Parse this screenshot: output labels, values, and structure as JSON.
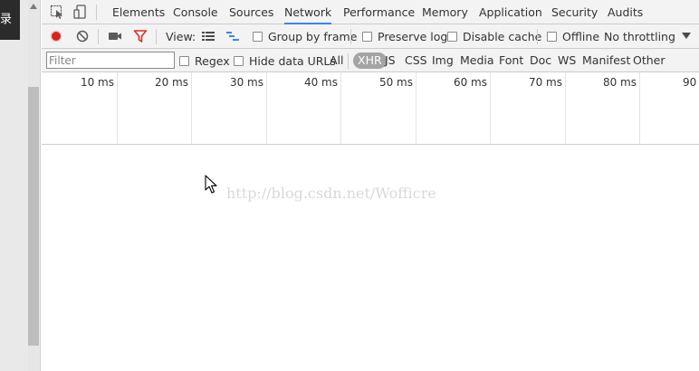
{
  "page": {
    "side_text": "录"
  },
  "tabbar": {
    "icons": [
      "inspect-element-icon",
      "device-toolbar-icon"
    ],
    "tabs": [
      {
        "label": "Elements"
      },
      {
        "label": "Console"
      },
      {
        "label": "Sources"
      },
      {
        "label": "Network",
        "active": true
      },
      {
        "label": "Performance"
      },
      {
        "label": "Memory"
      },
      {
        "label": "Application"
      },
      {
        "label": "Security"
      },
      {
        "label": "Audits"
      }
    ],
    "accent_color": "#3e82f7"
  },
  "toolbar": {
    "record_color": "#e0201b",
    "filter_icon_color": "#d93025",
    "view_label": "View:",
    "group_by_frame": "Group by frame",
    "preserve_log": "Preserve log",
    "disable_cache": "Disable cache",
    "offline": "Offline",
    "throttling": "No throttling"
  },
  "filterbar": {
    "placeholder": "Filter",
    "regex": "Regex",
    "hide_data_urls": "Hide data URLs",
    "types": [
      "All",
      "XHR",
      "JS",
      "CSS",
      "Img",
      "Media",
      "Font",
      "Doc",
      "WS",
      "Manifest",
      "Other"
    ],
    "selected_type": "XHR"
  },
  "timeline": {
    "ticks": [
      "10 ms",
      "20 ms",
      "30 ms",
      "40 ms",
      "50 ms",
      "60 ms",
      "70 ms",
      "80 ms",
      "90"
    ]
  },
  "content": {
    "watermark": "http://blog.csdn.net/Wofficre"
  }
}
